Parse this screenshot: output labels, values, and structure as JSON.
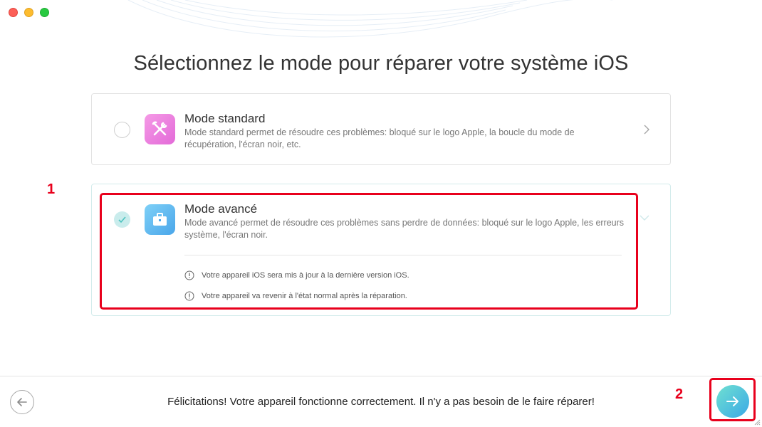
{
  "window": {
    "title": "Sélectionnez le mode pour réparer votre système iOS"
  },
  "modes": {
    "standard": {
      "title": "Mode standard",
      "description": "Mode standard permet de résoudre ces problèmes: bloqué sur le logo Apple, la boucle du mode de récupération, l'écran noir, etc.",
      "icon": "tools-icon",
      "selected": false
    },
    "advanced": {
      "title": "Mode avancé",
      "description": "Mode avancé permet de résoudre ces problèmes sans perdre de données: bloqué sur le logo Apple, les erreurs système, l'écran noir.",
      "icon": "toolbox-icon",
      "selected": true,
      "notes": [
        "Votre appareil iOS sera mis à jour à la dernière version iOS.",
        "Votre appareil va revenir à l'état normal après la réparation."
      ]
    }
  },
  "annotations": {
    "step1": "1",
    "step2": "2"
  },
  "footer": {
    "message": "Félicitations! Votre appareil fonctionne correctement. Il n'y a pas besoin de le faire réparer!"
  },
  "colors": {
    "annotation_red": "#e8001c",
    "accent_teal": "#3ba9e6",
    "standard_icon": "#e36ad8",
    "advanced_icon": "#4aa6ea"
  }
}
